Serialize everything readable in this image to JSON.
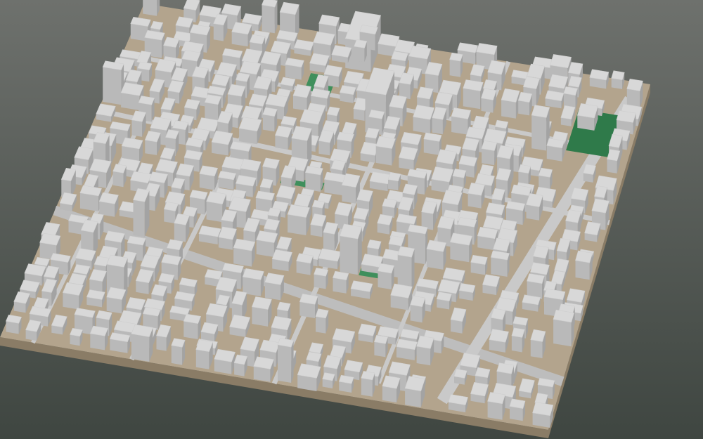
{
  "scene": {
    "kind": "3d-city-block-model",
    "colors": {
      "background_top": "#6e716d",
      "background_bottom": "#3f4641",
      "ground": "#b3a48d",
      "ground_light": "#c4b7a1",
      "ground_side": "#8a7c66",
      "building_top": "#d8d8d8",
      "building_left": "#b9b9b9",
      "building_right": "#a3a3a3",
      "road": "#c9c9c9",
      "rail": "#bdbdbd",
      "green": "#3f8f5c",
      "green_dark": "#2f7a4a",
      "water": "#8fb4c9"
    },
    "features": {
      "districts": 6,
      "parks": 4,
      "roads": [
        "main-diagonal-avenue",
        "rail-corridor",
        "cross-streets"
      ]
    }
  }
}
